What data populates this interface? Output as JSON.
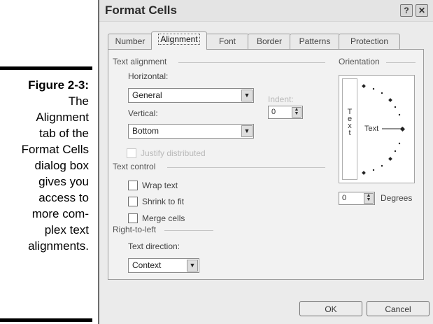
{
  "caption": {
    "figure": "Figure 2-3:",
    "lines": [
      "The",
      "Alignment",
      "tab of the",
      "Format Cells",
      "dialog box",
      "gives you",
      "access to",
      "more com-",
      "plex text",
      "alignments."
    ]
  },
  "dialog": {
    "title": "Format Cells",
    "help_icon": "?",
    "close_icon": "✕",
    "tabs": [
      "Number",
      "Alignment",
      "Font",
      "Border",
      "Patterns",
      "Protection"
    ],
    "active_tab": "Alignment",
    "text_alignment": {
      "group_label": "Text alignment",
      "horizontal_label": "Horizontal:",
      "horizontal_value": "General",
      "vertical_label": "Vertical:",
      "vertical_value": "Bottom",
      "indent_label": "Indent:",
      "indent_value": "0",
      "justify_distributed_label": "Justify distributed"
    },
    "text_control": {
      "group_label": "Text control",
      "wrap_text": "Wrap text",
      "shrink_to_fit": "Shrink to fit",
      "merge_cells": "Merge cells"
    },
    "right_to_left": {
      "group_label": "Right-to-left",
      "text_direction_label": "Text direction:",
      "text_direction_value": "Context"
    },
    "orientation": {
      "group_label": "Orientation",
      "vertical_text": [
        "T",
        "e",
        "x",
        "t"
      ],
      "dial_text": "Text",
      "degrees_value": "0",
      "degrees_label": "Degrees"
    },
    "buttons": {
      "ok": "OK",
      "cancel": "Cancel"
    }
  }
}
